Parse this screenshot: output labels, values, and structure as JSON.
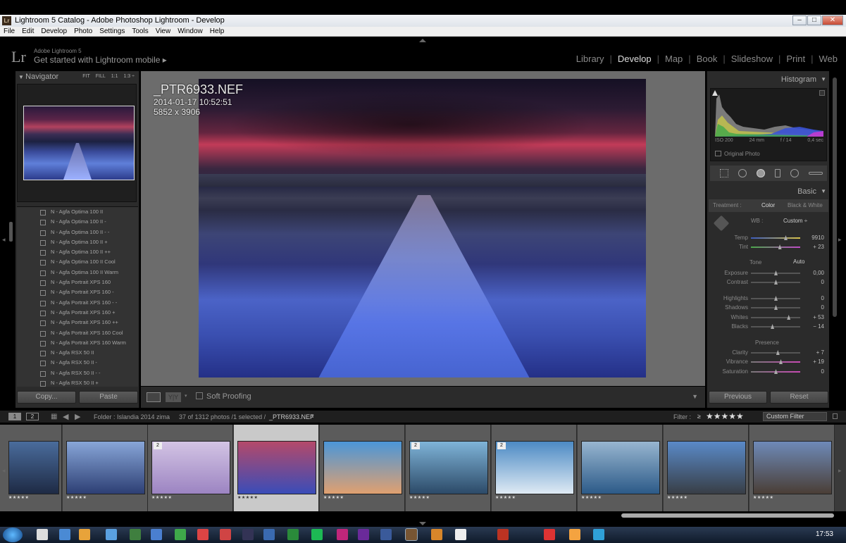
{
  "window": {
    "title": "Lightroom 5 Catalog - Adobe Photoshop Lightroom - Develop",
    "app_icon": "Lr"
  },
  "menu": [
    "File",
    "Edit",
    "Develop",
    "Photo",
    "Settings",
    "Tools",
    "View",
    "Window",
    "Help"
  ],
  "identity": {
    "logo": "Lr",
    "version": "Adobe Lightroom 5",
    "mobile_link": "Get started with Lightroom mobile ▸"
  },
  "modules": [
    {
      "label": "Library",
      "active": false
    },
    {
      "label": "Develop",
      "active": true
    },
    {
      "label": "Map",
      "active": false
    },
    {
      "label": "Book",
      "active": false
    },
    {
      "label": "Slideshow",
      "active": false
    },
    {
      "label": "Print",
      "active": false
    },
    {
      "label": "Web",
      "active": false
    }
  ],
  "navigator": {
    "title": "Navigator",
    "options": [
      "FIT",
      "FILL",
      "1:1",
      "1:3 ÷"
    ]
  },
  "presets": [
    "N - Agfa Optima 100 II",
    "N - Agfa Optima 100 II -",
    "N - Agfa Optima 100 II - -",
    "N - Agfa Optima 100 II +",
    "N - Agfa Optima 100 II ++",
    "N - Agfa Optima 100 II Cool",
    "N - Agfa Optima 100 II Warm",
    "N - Agfa Portrait XPS 160",
    "N - Agfa Portrait XPS 160 -",
    "N - Agfa Portrait XPS 160 - -",
    "N - Agfa Portrait XPS 160 +",
    "N - Agfa Portrait XPS 160 ++",
    "N - Agfa Portrait XPS 160 Cool",
    "N - Agfa Portrait XPS 160 Warm",
    "N - Agfa RSX 50 II",
    "N - Agfa RSX 50 II -",
    "N - Agfa RSX 50 II - -",
    "N - Agfa RSX 50 II +"
  ],
  "left_buttons": {
    "copy": "Copy...",
    "paste": "Paste"
  },
  "photo": {
    "filename": "_PTR6933.NEF",
    "datetime": "2014-01-17 10:52:51",
    "dimensions": "5852 x 3906"
  },
  "toolbar": {
    "soft_proofing": "Soft Proofing",
    "compare_label": "Y|Y"
  },
  "histogram": {
    "title": "Histogram",
    "iso": "ISO 200",
    "focal": "24 mm",
    "aperture": "f / 14",
    "shutter": "0,4 sec",
    "original_photo": "Original Photo"
  },
  "basic": {
    "title": "Basic",
    "treatment_label": "Treatment :",
    "treatment_color": "Color",
    "treatment_bw": "Black & White",
    "wb_label": "WB :",
    "wb_value": "Custom ÷",
    "tone_label": "Tone",
    "auto_label": "Auto",
    "presence_label": "Presence",
    "sliders": [
      {
        "label": "Temp",
        "value": "9910",
        "level": 0.7
      },
      {
        "label": "Tint",
        "value": "+ 23",
        "level": 0.58
      },
      {
        "label": "Exposure",
        "value": "0,00",
        "level": 0.5
      },
      {
        "label": "Contrast",
        "value": "0",
        "level": 0.5
      },
      {
        "label": "Highlights",
        "value": "0",
        "level": 0.5
      },
      {
        "label": "Shadows",
        "value": "0",
        "level": 0.5
      },
      {
        "label": "Whites",
        "value": "+ 53",
        "level": 0.76
      },
      {
        "label": "Blacks",
        "value": "− 14",
        "level": 0.43
      },
      {
        "label": "Clarity",
        "value": "+ 7",
        "level": 0.54
      },
      {
        "label": "Vibrance",
        "value": "+ 19",
        "level": 0.6
      },
      {
        "label": "Saturation",
        "value": "0",
        "level": 0.5
      }
    ]
  },
  "right_buttons": {
    "previous": "Previous",
    "reset": "Reset"
  },
  "filmbar": {
    "view1": "1",
    "view2": "2",
    "folder": "Folder : Islandia 2014 zima",
    "count": "37 of 1312 photos /1 selected /",
    "current": "_PTR6933.NEF",
    "filter_label": "Filter :",
    "filter_op": "≥",
    "filter_stars": "★★★★★",
    "custom_filter": "Custom Filter"
  },
  "thumbnails": [
    {
      "stars": "★★★★★",
      "badge": "",
      "selected": false,
      "colors": [
        "#4a6c9c",
        "#1e2a44"
      ]
    },
    {
      "stars": "★★★★★",
      "badge": "",
      "selected": false,
      "colors": [
        "#88a6d8",
        "#2d3f74"
      ]
    },
    {
      "stars": "★★★★★",
      "badge": "2",
      "selected": false,
      "colors": [
        "#d3c4e4",
        "#9c84c2"
      ]
    },
    {
      "stars": "★★★★★",
      "badge": "",
      "selected": true,
      "colors": [
        "#b44a6a",
        "#3a4cb8"
      ]
    },
    {
      "stars": "★★★★★",
      "badge": "",
      "selected": false,
      "colors": [
        "#4b96d8",
        "#e0a070"
      ]
    },
    {
      "stars": "★★★★★",
      "badge": "2",
      "selected": false,
      "colors": [
        "#7fb4d8",
        "#2c4a68"
      ]
    },
    {
      "stars": "★★★★★",
      "badge": "2",
      "selected": false,
      "colors": [
        "#4c8ac4",
        "#dfeaf4"
      ]
    },
    {
      "stars": "★★★★★",
      "badge": "",
      "selected": false,
      "colors": [
        "#98b6d0",
        "#2c5a88"
      ]
    },
    {
      "stars": "★★★★★",
      "badge": "",
      "selected": false,
      "colors": [
        "#5a8ac8",
        "#383e46"
      ]
    },
    {
      "stars": "★★★★★",
      "badge": "",
      "selected": false,
      "colors": [
        "#6e8ab8",
        "#4a3e36"
      ]
    }
  ],
  "taskbar": {
    "clock": "17:53"
  }
}
